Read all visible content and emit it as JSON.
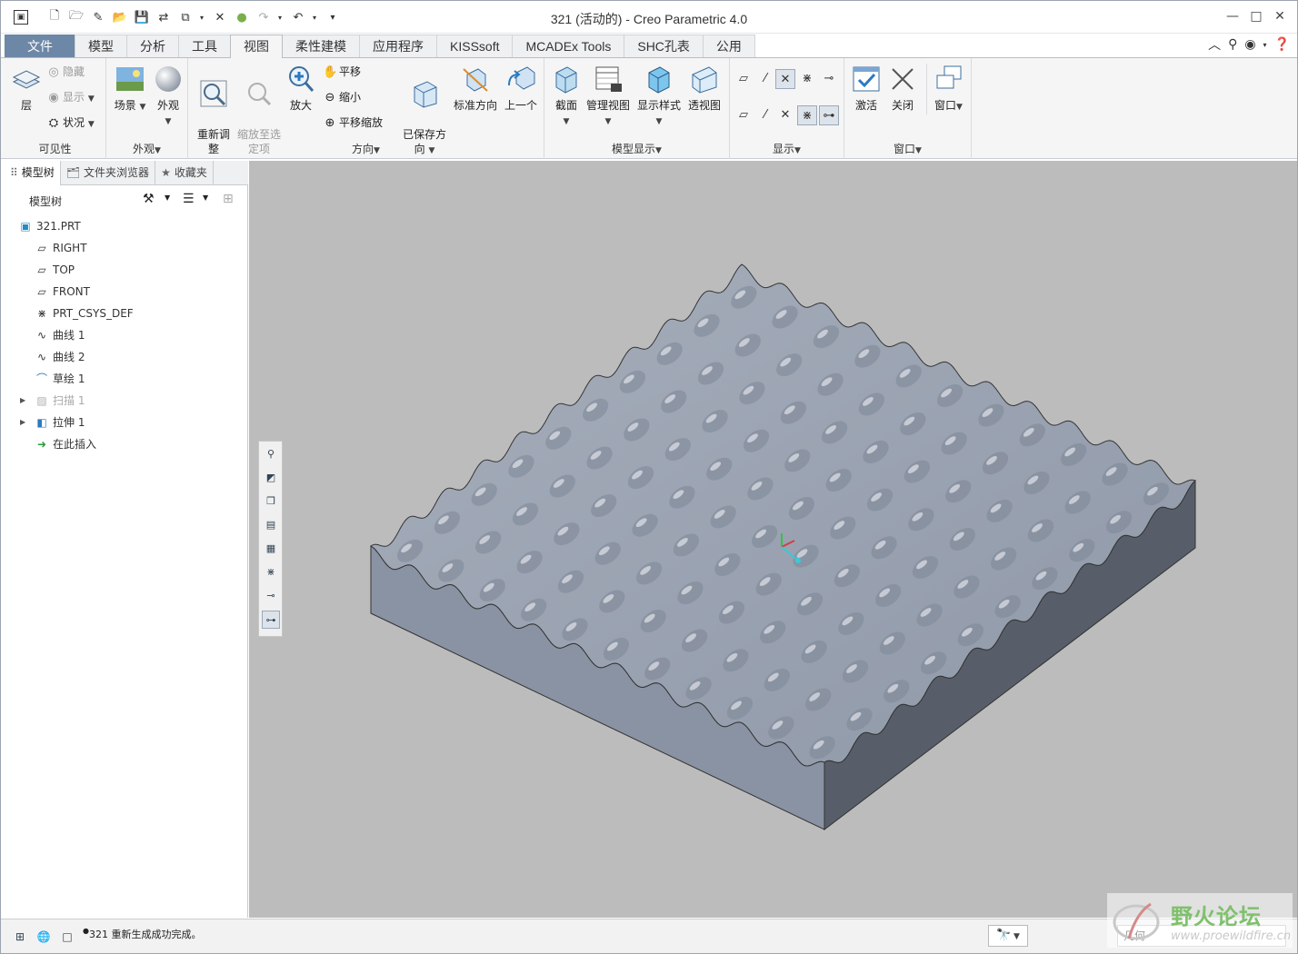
{
  "window": {
    "title": "321 (活动的) - Creo Parametric 4.0",
    "minimize_icon": "minimize-icon",
    "maximize_icon": "maximize-icon",
    "close_icon": "close-icon"
  },
  "quick_access": [
    "new-icon",
    "open-icon",
    "save-icon",
    "regenerate-icon",
    "window-icon",
    "close-window-icon",
    "undo-icon",
    "redo-icon"
  ],
  "tabs": [
    {
      "label": "文件",
      "file": true
    },
    {
      "label": "模型"
    },
    {
      "label": "分析"
    },
    {
      "label": "工具"
    },
    {
      "label": "视图",
      "active": true
    },
    {
      "label": "柔性建模"
    },
    {
      "label": "应用程序"
    },
    {
      "label": "KISSsoft"
    },
    {
      "label": "MCADEx Tools"
    },
    {
      "label": "SHC孔表"
    },
    {
      "label": "公用"
    }
  ],
  "ribbon": {
    "visibility": {
      "group_label": "可见性",
      "layers": "层",
      "hide": "隐藏",
      "show": "显示",
      "status": "状况"
    },
    "appearance": {
      "group_label": "外观",
      "scene": "场景",
      "appearance": "外观"
    },
    "orientation": {
      "group_label": "方向",
      "refit": "重新调\n整",
      "zoom_to_selected": "缩放至选\n定项",
      "zoom_in": "放大",
      "pan": "平移",
      "zoom_out": "缩小",
      "pan_zoom": "平移缩放",
      "saved_orientations": "已保存方\n向",
      "standard_orientation": "标准方向",
      "previous": "上一个"
    },
    "model_display": {
      "group_label": "模型显示",
      "section": "截面",
      "manage_views": "管理视图",
      "display_style": "显示样式",
      "perspective": "透视图"
    },
    "show": {
      "group_label": "显示"
    },
    "window": {
      "group_label": "窗口",
      "activate": "激活",
      "close": "关闭",
      "windows": "窗口"
    }
  },
  "panel": {
    "tabs": [
      {
        "label": "模型树",
        "icon": "model-tree-icon",
        "active": true
      },
      {
        "label": "文件夹浏览器",
        "icon": "folder-icon"
      },
      {
        "label": "收藏夹",
        "icon": "favorites-icon"
      }
    ],
    "tree_header": "模型树",
    "tree": [
      {
        "label": "321.PRT",
        "icon": "part-icon",
        "level": 0
      },
      {
        "label": "RIGHT",
        "icon": "datum-plane-icon",
        "level": 1
      },
      {
        "label": "TOP",
        "icon": "datum-plane-icon",
        "level": 1
      },
      {
        "label": "FRONT",
        "icon": "datum-plane-icon",
        "level": 1
      },
      {
        "label": "PRT_CSYS_DEF",
        "icon": "csys-icon",
        "level": 1
      },
      {
        "label": "曲线 1",
        "icon": "curve-icon",
        "level": 1
      },
      {
        "label": "曲线 2",
        "icon": "curve-icon",
        "level": 1
      },
      {
        "label": "草绘 1",
        "icon": "sketch-icon",
        "level": 1
      },
      {
        "label": "扫描 1",
        "icon": "sweep-icon",
        "level": 1,
        "expandable": true,
        "dim": true
      },
      {
        "label": "拉伸 1",
        "icon": "extrude-icon",
        "level": 1,
        "expandable": true
      },
      {
        "label": "在此插入",
        "icon": "insert-here-icon",
        "level": 1
      }
    ]
  },
  "status": {
    "message": "321 重新生成成功完成。",
    "filter": "几何"
  },
  "watermark": {
    "text": "野火论坛",
    "url": "www.proewildfire.cn"
  },
  "colors": {
    "file_tab": "#6d87a6",
    "viewport_bg": "#bcbcbc",
    "model_top": "#9aa3b3",
    "model_side_front": "#8a93a3",
    "model_side_right": "#585e69"
  }
}
